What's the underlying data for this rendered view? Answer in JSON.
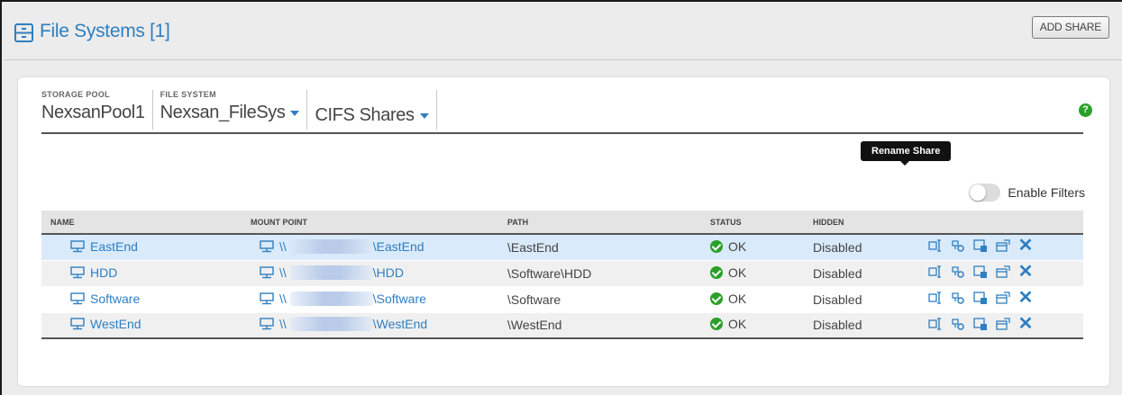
{
  "header": {
    "title": "File Systems [1]",
    "icon": "file-system-icon",
    "add_share_label": "ADD SHARE"
  },
  "breadcrumb": {
    "storage_pool": {
      "label": "STORAGE POOL",
      "value": "NexsanPool1"
    },
    "file_system": {
      "label": "FILE SYSTEM",
      "value": "Nexsan_FileSys"
    },
    "share_type": {
      "value": "CIFS Shares"
    }
  },
  "help_label": "?",
  "filters": {
    "label": "Enable Filters",
    "enabled": false
  },
  "table": {
    "columns": [
      "NAME",
      "MOUNT POINT",
      "PATH",
      "STATUS",
      "HIDDEN"
    ],
    "rows": [
      {
        "name": "EastEnd",
        "mount_prefix": "\\\\",
        "mount_suffix": "\\EastEnd",
        "path": "\\EastEnd",
        "status": "OK",
        "hidden": "Disabled",
        "selected": true
      },
      {
        "name": "HDD",
        "mount_prefix": "\\\\",
        "mount_suffix": "\\HDD",
        "path": "\\Software\\HDD",
        "status": "OK",
        "hidden": "Disabled",
        "selected": false
      },
      {
        "name": "Software",
        "mount_prefix": "\\\\",
        "mount_suffix": "\\Software",
        "path": "\\Software",
        "status": "OK",
        "hidden": "Disabled",
        "selected": false
      },
      {
        "name": "WestEnd",
        "mount_prefix": "\\\\",
        "mount_suffix": "\\WestEnd",
        "path": "\\WestEnd",
        "status": "OK",
        "hidden": "Disabled",
        "selected": false
      }
    ],
    "row_actions": [
      "rename-share-icon",
      "share-permissions-icon",
      "share-settings-icon",
      "edit-share-icon",
      "delete-share-icon"
    ]
  },
  "tooltip": {
    "text": "Rename Share"
  },
  "colors": {
    "accent": "#2e7fc2",
    "ok": "#2aa02a",
    "selected_row": "#d9eafa"
  }
}
